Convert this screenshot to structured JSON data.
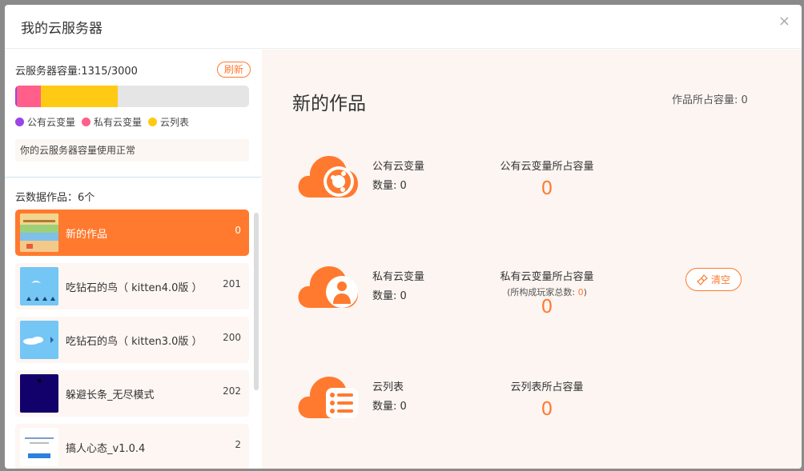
{
  "modal": {
    "title": "我的云服务器",
    "close_glyph": "×"
  },
  "capacity": {
    "label": "云服务器容量:1315/3000",
    "refresh_label": "刷新",
    "used": 1315,
    "total": 3000,
    "segments": [
      {
        "name": "公有云变量",
        "color": "#9b44e8",
        "value": 23
      },
      {
        "name": "私有云变量",
        "color": "#ff5f8a",
        "value": 307
      },
      {
        "name": "云列表",
        "color": "#ffca14",
        "value": 985
      }
    ],
    "legend": [
      "公有云变量",
      "私有云变量",
      "云列表"
    ],
    "status": "你的云服务器容量使用正常"
  },
  "works": {
    "header": "云数据作品：6个",
    "items": [
      {
        "name": "新的作品",
        "count": "0",
        "active": true,
        "thumb": "game-scene"
      },
      {
        "name": "吃钻石的鸟（ kitten4.0版 ）",
        "count": "201",
        "active": false,
        "thumb": "sky-bird"
      },
      {
        "name": "吃钻石的鸟（ kitten3.0版 ）",
        "count": "200",
        "active": false,
        "thumb": "sky-bird2"
      },
      {
        "name": "躲避长条_无尽模式",
        "count": "202",
        "active": false,
        "thumb": "dark"
      },
      {
        "name": "搞人心态_v1.0.4",
        "count": "2",
        "active": false,
        "thumb": "doc"
      }
    ]
  },
  "main": {
    "title": "新的作品",
    "total_capacity": "作品所占容量: 0",
    "public": {
      "name": "公有云变量",
      "count": "数量: 0",
      "cap_label": "公有云变量所占容量",
      "cap_value": "0"
    },
    "private": {
      "name": "私有云变量",
      "count": "数量: 0",
      "cap_label": "私有云变量所占容量",
      "sub_prefix": "(所构成玩家总数: ",
      "sub_value": "0",
      "sub_suffix": ")",
      "cap_value": "0",
      "clear_label": "清空"
    },
    "list": {
      "name": "云列表",
      "count": "数量: 0",
      "cap_label": "云列表所占容量",
      "cap_value": "0"
    }
  },
  "colors": {
    "accent": "#ff7a2f",
    "panel_bg": "#fcf5f1"
  }
}
